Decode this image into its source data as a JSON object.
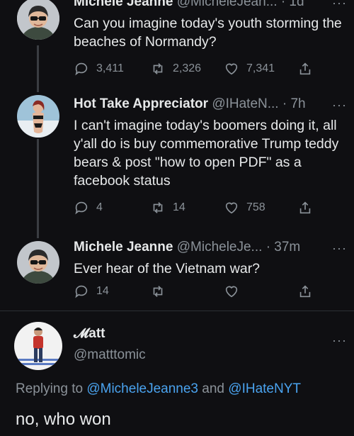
{
  "tweets": [
    {
      "name": "Michele Jeanne",
      "handle": "@MicheleJean...",
      "time": "· 1d",
      "text": "Can you imagine today's youth storming the beaches of Normandy?",
      "replies": "3,411",
      "retweets": "2,326",
      "likes": "7,341"
    },
    {
      "name": "Hot Take Appreciator",
      "handle": "@IHateN...",
      "time": "· 7h",
      "text": "I can't imagine today's boomers doing it, all y'all do is buy commemorative Trump teddy bears & post \"how to open PDF\" as a facebook status",
      "replies": "4",
      "retweets": "14",
      "likes": "758"
    },
    {
      "name": "Michele Jeanne",
      "handle": "@MicheleJe...",
      "time": "· 37m",
      "text": "Ever hear of the Vietnam war?",
      "replies": "14",
      "retweets": "",
      "likes": ""
    }
  ],
  "main": {
    "name": "𝓜att",
    "handle": "@matttomic",
    "replying_prefix": "Replying to ",
    "replying_user1": "@MicheleJeanne3",
    "replying_and": " and ",
    "replying_user2": "@IHateNYT",
    "text": "no, who won"
  },
  "more_label": "···",
  "icons": {
    "reply": "reply-icon",
    "retweet": "retweet-icon",
    "like": "heart-icon",
    "share": "share-icon",
    "more": "more-options-icon"
  },
  "colors": {
    "background": "#0f0f12",
    "text": "#e7e9ea",
    "secondary": "#8b9299",
    "link": "#4aa3ef"
  }
}
